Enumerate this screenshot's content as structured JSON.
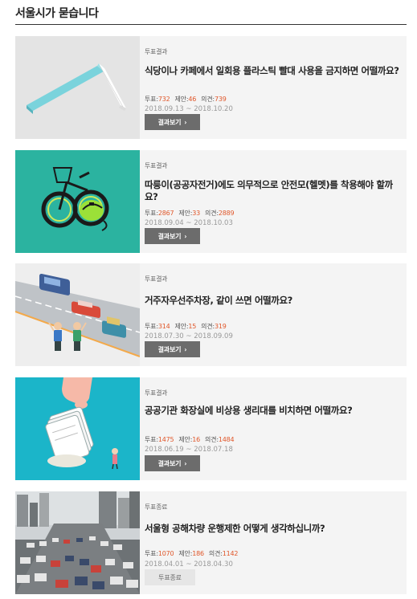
{
  "header": {
    "title": "서울시가 묻습니다"
  },
  "labels": {
    "votes": "투표:",
    "proposals": "제안:",
    "opinions": "의견:",
    "chevron": "›"
  },
  "cards": [
    {
      "status": "투표결과",
      "title": "식당이나 카페에서 일회용 플라스틱 빨대 사용을 금지하면 어떨까요?",
      "votes": "732",
      "proposals": "46",
      "opinions": "739",
      "period": "2018.09.13 ~ 2018.10.20",
      "button": "결과보기",
      "image": "plastic-straw-illustration"
    },
    {
      "status": "투표결과",
      "title": "따릉이(공공자전거)에도 의무적으로 안전모(헬멧)를 착용해야 할까요?",
      "votes": "2867",
      "proposals": "33",
      "opinions": "2889",
      "period": "2018.09.04 ~ 2018.10.03",
      "button": "결과보기",
      "image": "bicycle-helmet-illustration"
    },
    {
      "status": "투표결과",
      "title": "거주자우선주차장, 같이 쓰면 어떨까요?",
      "votes": "314",
      "proposals": "15",
      "opinions": "319",
      "period": "2018.07.30 ~ 2018.09.09",
      "button": "결과보기",
      "image": "parking-lot-illustration"
    },
    {
      "status": "투표결과",
      "title": "공공기관 화장실에 비상용 생리대를 비치하면 어떨까요?",
      "votes": "1475",
      "proposals": "16",
      "opinions": "1484",
      "period": "2018.06.19 ~ 2018.07.18",
      "button": "결과보기",
      "image": "sanitary-pad-illustration"
    },
    {
      "status": "투표종료",
      "title": "서울형 공해차량 운행제한 어떻게 생각하십니까?",
      "votes": "1070",
      "proposals": "186",
      "opinions": "1142",
      "period": "2018.04.01 ~ 2018.04.30",
      "button": "투표종료",
      "image": "traffic-jam-photo"
    }
  ],
  "colors": {
    "accent_number": "#e0572a",
    "button_bg": "#6c6c6c",
    "card_bg": "#f4f4f4"
  }
}
